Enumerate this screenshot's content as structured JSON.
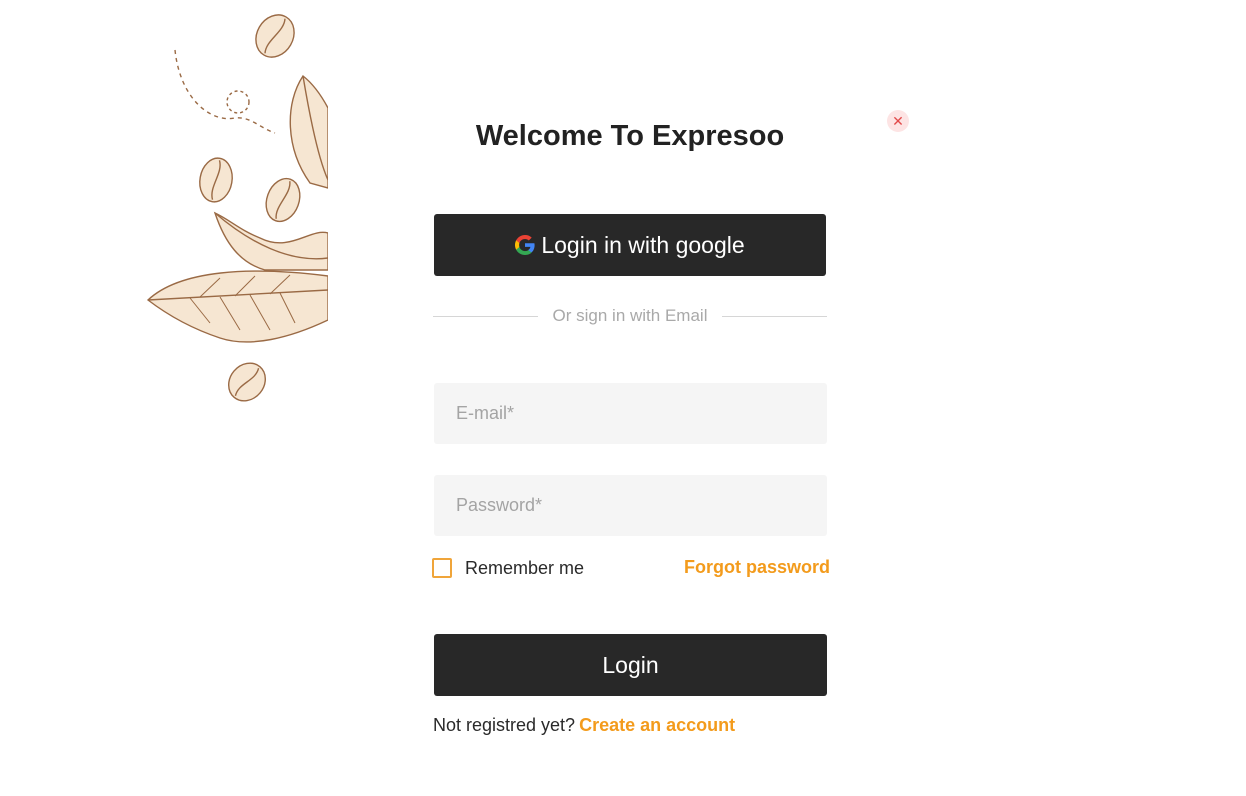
{
  "title": "Welcome To Expresoo",
  "close_icon": "close-icon",
  "google_button": {
    "label": "Login in with google",
    "icon": "google-icon"
  },
  "divider_text": "Or sign in with Email",
  "email": {
    "placeholder": "E-mail*",
    "value": ""
  },
  "password": {
    "placeholder": "Password*",
    "value": ""
  },
  "remember_me": {
    "label": "Remember me",
    "checked": false
  },
  "forgot_password": "Forgot password",
  "login_button": "Login",
  "register": {
    "text": "Not registred yet?",
    "link": "Create an account"
  },
  "colors": {
    "accent": "#f39b1c",
    "button_bg": "#282828",
    "field_bg": "#f5f5f5"
  }
}
